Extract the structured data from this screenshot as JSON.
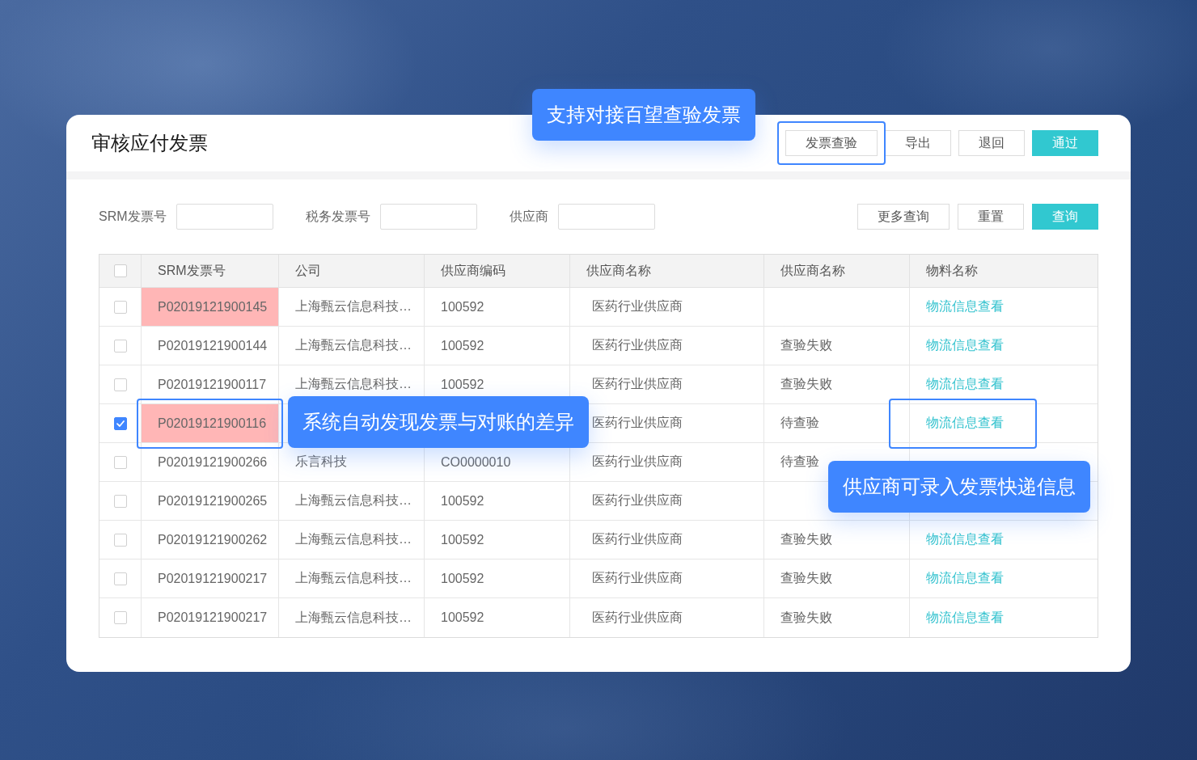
{
  "page": {
    "title": "审核应付发票",
    "actions": [
      {
        "label": "发票查验",
        "kind": "default",
        "framed": true
      },
      {
        "label": "导出",
        "kind": "default",
        "framed": false
      },
      {
        "label": "退回",
        "kind": "default",
        "framed": false
      },
      {
        "label": "通过",
        "kind": "primary",
        "framed": false
      }
    ]
  },
  "filters": {
    "fields": [
      {
        "label": "SRM发票号"
      },
      {
        "label": "税务发票号"
      },
      {
        "label": "供应商"
      }
    ],
    "buttons": [
      {
        "label": "更多查询",
        "kind": "default"
      },
      {
        "label": "重置",
        "kind": "default"
      },
      {
        "label": "查询",
        "kind": "primary"
      }
    ]
  },
  "table": {
    "select_all": {
      "checked": false
    },
    "columns": [
      "SRM发票号",
      "公司",
      "供应商编码",
      "供应商名称",
      "供应商名称",
      "物料名称"
    ],
    "rows": [
      {
        "checked": false,
        "flagged": true,
        "srm_no": "P02019121900145",
        "company": "上海甄云信息科技…",
        "supplier_code": "100592",
        "supplier_name": "医药行业供应商",
        "link": "物流信息查看",
        "srm_framed": false,
        "link_framed": false
      },
      {
        "checked": false,
        "flagged": false,
        "srm_no": "P02019121900144",
        "company": "上海甄云信息科技…",
        "supplier_code": "100592",
        "supplier_name": "医药行业供应商",
        "verification_status": "查验失败",
        "link": "物流信息查看",
        "srm_framed": false,
        "link_framed": false
      },
      {
        "checked": false,
        "flagged": false,
        "srm_no": "P02019121900117",
        "company": "上海甄云信息科技…",
        "supplier_code": "100592",
        "supplier_name": "医药行业供应商",
        "verification_status": "查验失败",
        "link": "物流信息查看",
        "srm_framed": false,
        "link_framed": false
      },
      {
        "checked": true,
        "flagged": true,
        "srm_no": "P02019121900116",
        "supplier_name": "医药行业供应商",
        "verification_status": "待查验",
        "link": "物流信息查看",
        "srm_framed": true,
        "link_framed": true
      },
      {
        "checked": false,
        "flagged": false,
        "srm_no": "P02019121900266",
        "company": "乐言科技",
        "supplier_code": "CO0000010",
        "supplier_name": "医药行业供应商",
        "verification_status": "待查验",
        "srm_framed": false,
        "link_framed": false
      },
      {
        "checked": false,
        "flagged": false,
        "srm_no": "P02019121900265",
        "company": "上海甄云信息科技…",
        "supplier_code": "100592",
        "supplier_name": "医药行业供应商",
        "srm_framed": false,
        "link_framed": false
      },
      {
        "checked": false,
        "flagged": false,
        "srm_no": "P02019121900262",
        "company": "上海甄云信息科技…",
        "supplier_code": "100592",
        "supplier_name": "医药行业供应商",
        "verification_status": "查验失败",
        "link": "物流信息查看",
        "srm_framed": false,
        "link_framed": false
      },
      {
        "checked": false,
        "flagged": false,
        "srm_no": "P02019121900217",
        "company": "上海甄云信息科技…",
        "supplier_code": "100592",
        "supplier_name": "医药行业供应商",
        "verification_status": "查验失败",
        "link": "物流信息查看",
        "srm_framed": false,
        "link_framed": false
      },
      {
        "checked": false,
        "flagged": false,
        "srm_no": "P02019121900217",
        "company": "上海甄云信息科技…",
        "supplier_code": "100592",
        "supplier_name": "医药行业供应商",
        "verification_status": "查验失败",
        "link": "物流信息查看",
        "srm_framed": false,
        "link_framed": false
      }
    ]
  },
  "callouts": [
    {
      "text": "支持对接百望查验发票"
    },
    {
      "text": "系统自动发现发票与对账的差异"
    },
    {
      "text": "供应商可录入发票快递信息"
    }
  ]
}
